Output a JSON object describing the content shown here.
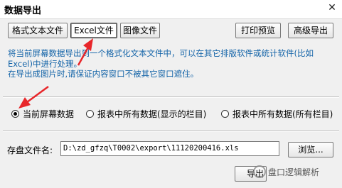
{
  "window": {
    "title": "数据导出",
    "close_symbol": "✕"
  },
  "tabs": [
    {
      "label": "格式文本文件"
    },
    {
      "label": "Excel文件"
    },
    {
      "label": "图像文件"
    }
  ],
  "toolbar": {
    "print_preview": "打印预览",
    "advanced_export": "高级导出"
  },
  "description": {
    "line1": "将当前屏幕数据导出到一个格式化文本文件中，可以在其它排版软件或统计软件(比如",
    "line2": "Excel)中进行处理。",
    "line3": "在导出成图片时,请保证内容窗口不被其它窗口遮住。"
  },
  "options": [
    {
      "label": "当前屏幕数据",
      "checked": true
    },
    {
      "label": "报表中所有数据(显示的栏目)",
      "checked": false
    },
    {
      "label": "报表中所有数据(所有栏目)",
      "checked": false
    }
  ],
  "save": {
    "label": "存盘文件名:",
    "path": "D:\\zd_gfzq\\T0002\\export\\11120200416.xls",
    "browse_label": "浏览..."
  },
  "footer": {
    "export_label": "导出"
  },
  "watermark": {
    "text": "盘口逻辑解析"
  },
  "colors": {
    "description_text": "#1464a8",
    "annotation_arrow": "#e8262a"
  }
}
